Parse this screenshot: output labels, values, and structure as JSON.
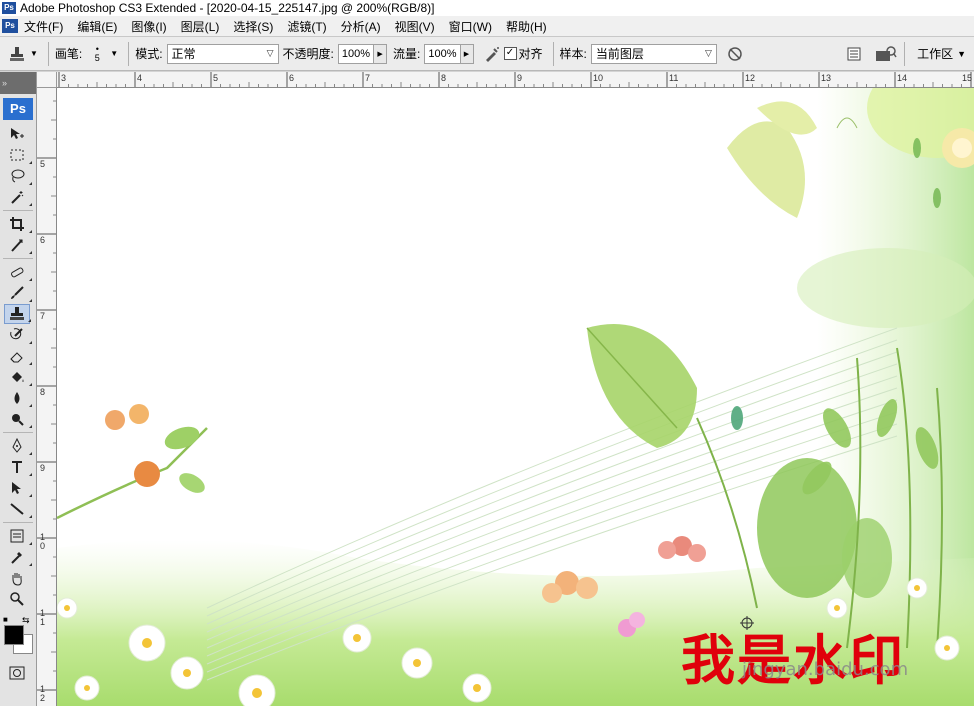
{
  "window": {
    "app_icon": "Ps",
    "title": "Adobe Photoshop CS3 Extended - [2020-04-15_225147.jpg @ 200%(RGB/8)]"
  },
  "menubar": {
    "app_icon": "Ps",
    "items": [
      "文件(F)",
      "编辑(E)",
      "图像(I)",
      "图层(L)",
      "选择(S)",
      "滤镜(T)",
      "分析(A)",
      "视图(V)",
      "窗口(W)",
      "帮助(H)"
    ]
  },
  "options": {
    "tool_icon": "clone-stamp-icon",
    "brush_label": "画笔:",
    "brush_size": "5",
    "mode_label": "模式:",
    "mode_value": "正常",
    "opacity_label": "不透明度:",
    "opacity_value": "100%",
    "flow_label": "流量:",
    "flow_value": "100%",
    "aligned_label": "对齐",
    "aligned_checked": true,
    "sample_label": "样本:",
    "sample_value": "当前图层",
    "workspace_label": "工作区"
  },
  "toolbox": {
    "logo": "Ps",
    "active_tool": "clone-stamp-tool"
  },
  "rulers": {
    "horizontal_labels": [
      "3",
      "4",
      "5",
      "6",
      "7",
      "8",
      "9",
      "10",
      "11",
      "12",
      "13",
      "14",
      "15"
    ],
    "vertical_labels": [
      "5",
      "6",
      "7",
      "8",
      "9",
      "10",
      "11",
      "12"
    ]
  },
  "document": {
    "watermark_text": "我是水印",
    "site_mark": "jingyan.baidu.com"
  },
  "colors": {
    "accent": "#2a6fcf",
    "foreground": "#000000",
    "background": "#ffffff",
    "watermark": "#e0000b"
  }
}
